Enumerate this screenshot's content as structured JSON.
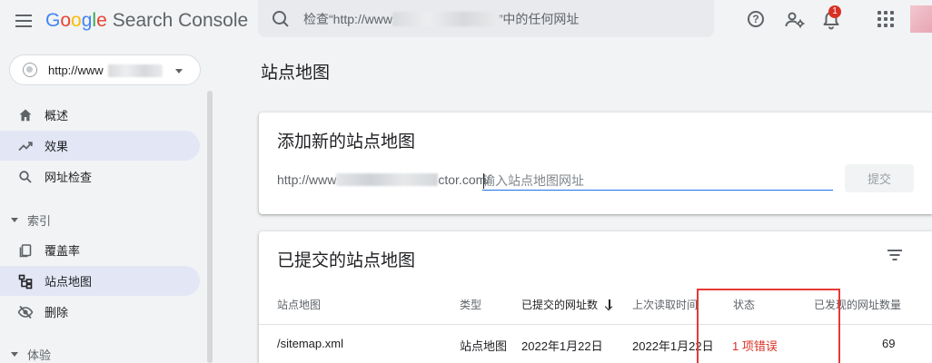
{
  "app": {
    "logo_letters": [
      "G",
      "o",
      "o",
      "g",
      "l",
      "e"
    ],
    "product_name": "Search Console"
  },
  "search": {
    "placeholder": "检查“http://www                        om/”中的任何网址"
  },
  "header": {
    "notification_count": "1",
    "icons": [
      "help-icon",
      "user-settings-icon",
      "bell-icon",
      "apps-icon"
    ]
  },
  "sidebar": {
    "property_label": "http://www",
    "items": [
      {
        "label": "概述",
        "icon": "home-icon",
        "active": false
      },
      {
        "label": "效果",
        "icon": "trending-up-icon",
        "active": true
      },
      {
        "label": "网址检查",
        "icon": "search-icon",
        "active": false
      }
    ],
    "sections": [
      {
        "label": "索引",
        "items": [
          {
            "label": "覆盖率",
            "icon": "coverage-icon",
            "active": false
          },
          {
            "label": "站点地图",
            "icon": "sitemap-icon",
            "active": true
          },
          {
            "label": "删除",
            "icon": "visibility-off-icon",
            "active": false
          }
        ]
      },
      {
        "label": "体验",
        "items": []
      }
    ]
  },
  "main": {
    "page_title": "站点地图",
    "add_card": {
      "title": "添加新的站点地图",
      "url_prefix_start": "http://www",
      "url_prefix_end": "ctor.com/",
      "input_placeholder": "输入站点地图网址",
      "submit_label": "提交"
    },
    "submitted_card": {
      "title": "已提交的站点地图",
      "columns": [
        "站点地图",
        "类型",
        "已提交的网址数",
        "上次读取时间",
        "状态",
        "已发现的网址数量"
      ],
      "rows": [
        {
          "sitemap": "/sitemap.xml",
          "type": "站点地图",
          "submitted": "2022年1月22日",
          "last_read": "2022年1月22日",
          "status": "1 项错误",
          "discovered": "69"
        }
      ]
    }
  },
  "colors": {
    "accent": "#1a73e8",
    "error": "#d93025",
    "active_nav": "#e3e7f5",
    "highlight_box": "#e53935"
  }
}
